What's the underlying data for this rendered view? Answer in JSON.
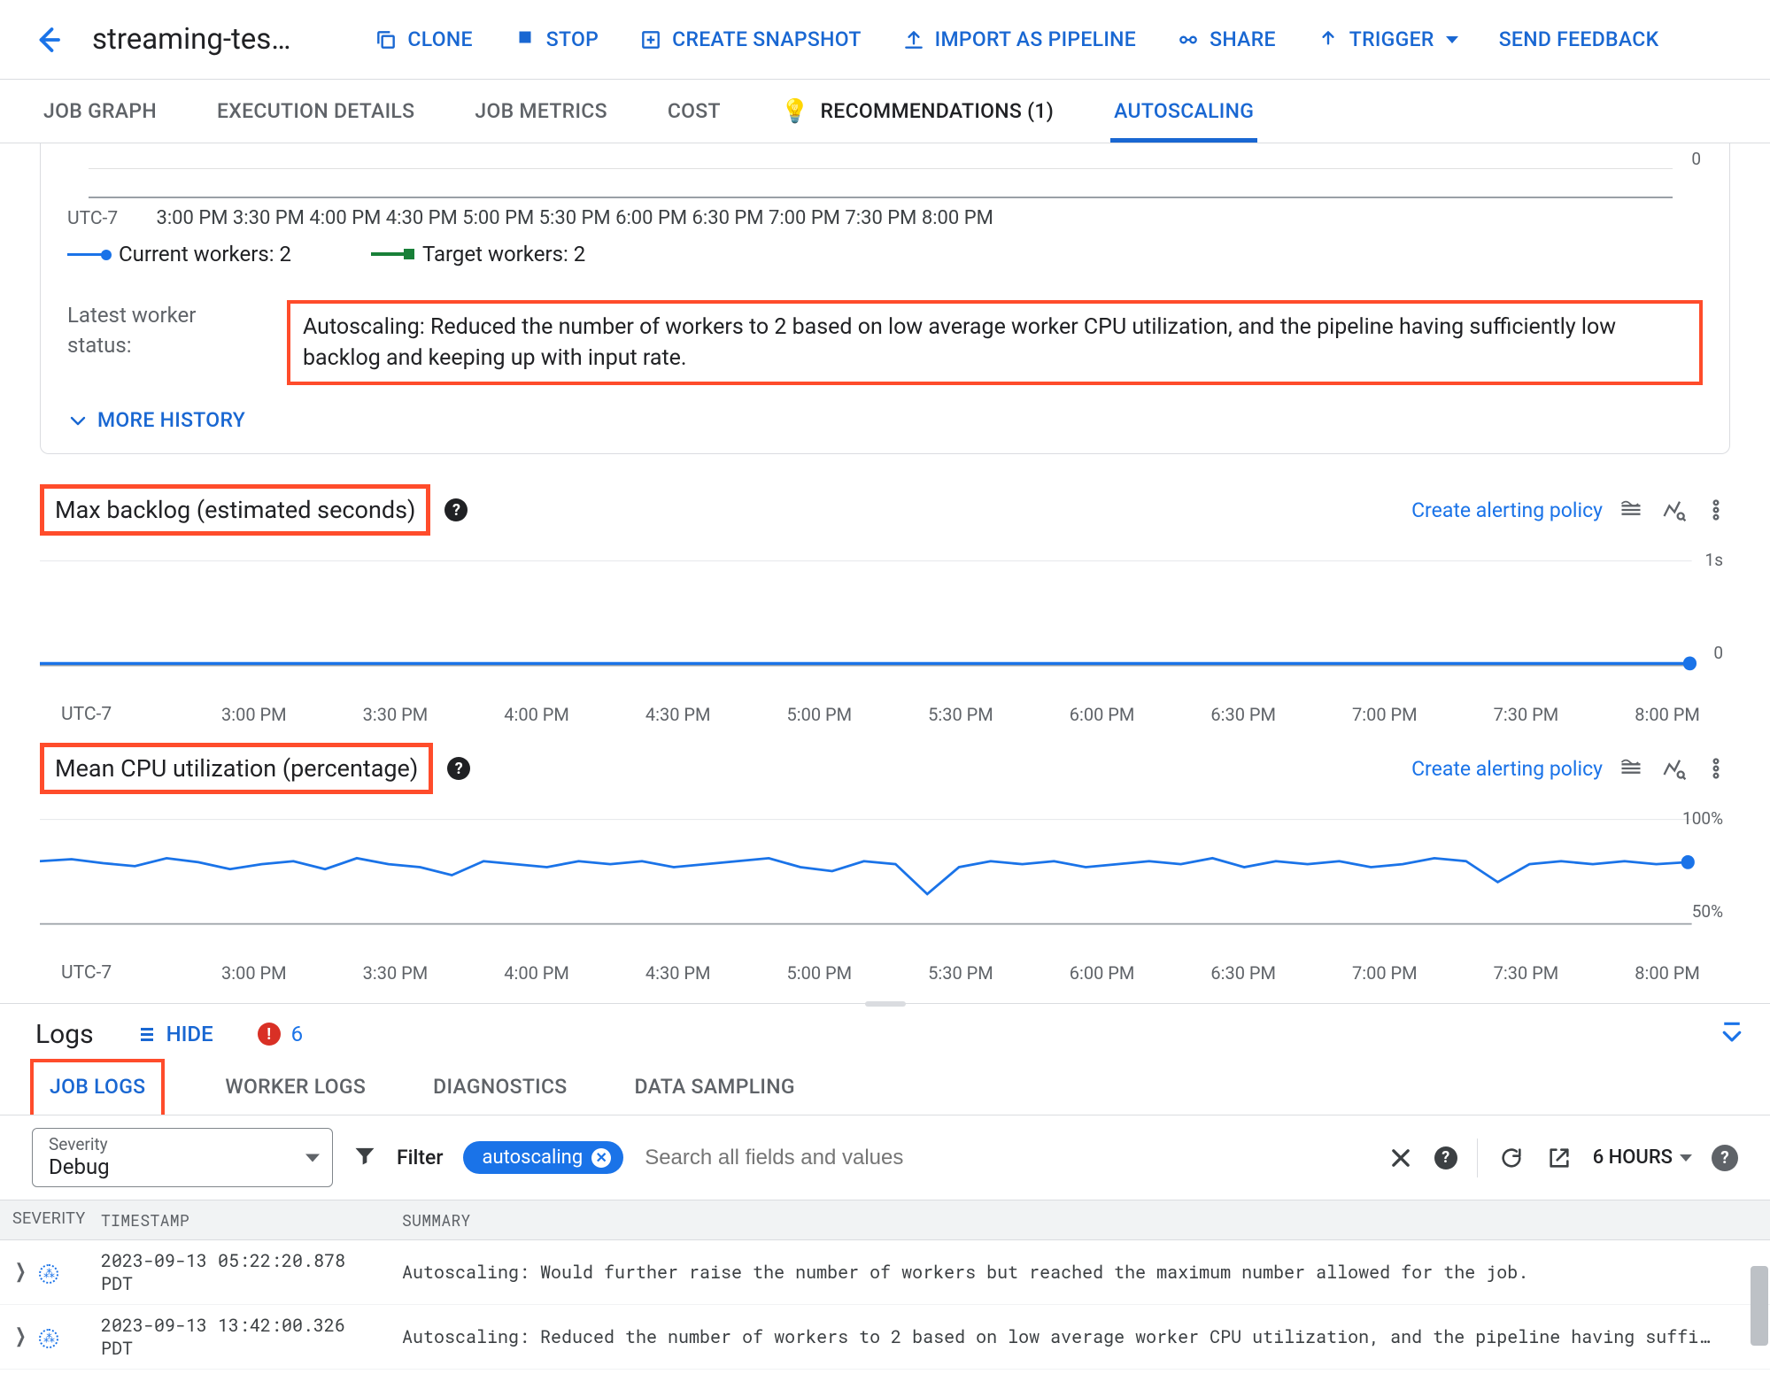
{
  "header": {
    "job_title": "streaming-tes…",
    "actions": {
      "clone": "CLONE",
      "stop": "STOP",
      "snapshot": "CREATE SNAPSHOT",
      "import": "IMPORT AS PIPELINE",
      "share": "SHARE",
      "trigger": "TRIGGER",
      "feedback": "SEND FEEDBACK"
    }
  },
  "tabs": {
    "job_graph": "JOB GRAPH",
    "exec": "EXECUTION DETAILS",
    "metrics": "JOB METRICS",
    "cost": "COST",
    "recs": "RECOMMENDATIONS (1)",
    "autoscaling": "AUTOSCALING"
  },
  "workers_card": {
    "utc": "UTC-7",
    "ticks": [
      "3:00 PM",
      "3:30 PM",
      "4:00 PM",
      "4:30 PM",
      "5:00 PM",
      "5:30 PM",
      "6:00 PM",
      "6:30 PM",
      "7:00 PM",
      "7:30 PM",
      "8:00 PM"
    ],
    "zero": "0",
    "legend_current": "Current workers:  2",
    "legend_target": "Target workers:  2",
    "status_label": "Latest worker status:",
    "status_text": "Autoscaling: Reduced the number of workers to 2 based on low average worker CPU utilization, and the pipeline having sufficiently low backlog and keeping up with input rate.",
    "more": "MORE HISTORY"
  },
  "panel_backlog": {
    "title": "Max backlog (estimated seconds)",
    "alert": "Create alerting policy",
    "y_top": "1s",
    "y_bot": "0",
    "utc": "UTC-7",
    "ticks": [
      "3:00 PM",
      "3:30 PM",
      "4:00 PM",
      "4:30 PM",
      "5:00 PM",
      "5:30 PM",
      "6:00 PM",
      "6:30 PM",
      "7:00 PM",
      "7:30 PM",
      "8:00 PM"
    ]
  },
  "panel_cpu": {
    "title": "Mean CPU utilization (percentage)",
    "alert": "Create alerting policy",
    "y_top": "100%",
    "y_bot": "50%",
    "utc": "UTC-7",
    "ticks": [
      "3:00 PM",
      "3:30 PM",
      "4:00 PM",
      "4:30 PM",
      "5:00 PM",
      "5:30 PM",
      "6:00 PM",
      "6:30 PM",
      "7:00 PM",
      "7:30 PM",
      "8:00 PM"
    ]
  },
  "logs": {
    "title": "Logs",
    "hide": "HIDE",
    "err_count": "6",
    "tabs": {
      "job": "JOB LOGS",
      "worker": "WORKER LOGS",
      "diag": "DIAGNOSTICS",
      "sampling": "DATA SAMPLING"
    },
    "severity_label": "Severity",
    "severity_value": "Debug",
    "filter_label": "Filter",
    "filter_chip": "autoscaling",
    "search_placeholder": "Search all fields and values",
    "time_range": "6 HOURS",
    "cols": {
      "sev": "SEVERITY",
      "ts": "TIMESTAMP",
      "sum": "SUMMARY"
    },
    "rows": [
      {
        "ts": "2023-09-13 05:22:20.878 PDT",
        "sum": "Autoscaling: Would further raise the number of workers but reached the maximum number allowed for the job."
      },
      {
        "ts": "2023-09-13 13:42:00.326 PDT",
        "sum": "Autoscaling: Reduced the number of workers to 2 based on low average worker CPU utilization, and the pipeline having suffi…"
      }
    ]
  },
  "chart_data": [
    {
      "type": "line",
      "title": "Workers",
      "x_ticks": [
        "3:00 PM",
        "3:30 PM",
        "4:00 PM",
        "4:30 PM",
        "5:00 PM",
        "5:30 PM",
        "6:00 PM",
        "6:30 PM",
        "7:00 PM",
        "7:30 PM",
        "8:00 PM"
      ],
      "series": [
        {
          "name": "Current workers",
          "value_label": "2"
        },
        {
          "name": "Target workers",
          "value_label": "2"
        }
      ],
      "ylim": [
        0,
        null
      ]
    },
    {
      "type": "line",
      "title": "Max backlog (estimated seconds)",
      "x_ticks": [
        "3:00 PM",
        "3:30 PM",
        "4:00 PM",
        "4:30 PM",
        "5:00 PM",
        "5:30 PM",
        "6:00 PM",
        "6:30 PM",
        "7:00 PM",
        "7:30 PM",
        "8:00 PM"
      ],
      "series": [
        {
          "name": "backlog",
          "constant_value": 0
        }
      ],
      "ylim": [
        0,
        1
      ],
      "y_unit": "s"
    },
    {
      "type": "line",
      "title": "Mean CPU utilization (percentage)",
      "x_ticks": [
        "3:00 PM",
        "3:30 PM",
        "4:00 PM",
        "4:30 PM",
        "5:00 PM",
        "5:30 PM",
        "6:00 PM",
        "6:30 PM",
        "7:00 PM",
        "7:30 PM",
        "8:00 PM"
      ],
      "series": [
        {
          "name": "cpu",
          "values": [
            72,
            72,
            71,
            70,
            73,
            72,
            70,
            71,
            72,
            70,
            73,
            71,
            70,
            68,
            72,
            71,
            70,
            72,
            71,
            72,
            70,
            71,
            72,
            73,
            70,
            69,
            72,
            71,
            60,
            70,
            72,
            71,
            72,
            70,
            71,
            72,
            71,
            73,
            70,
            72,
            71,
            72,
            70,
            71,
            73,
            72,
            71,
            70,
            63,
            71,
            72,
            71,
            72
          ]
        }
      ],
      "ylim": [
        50,
        100
      ],
      "y_unit": "%"
    }
  ]
}
